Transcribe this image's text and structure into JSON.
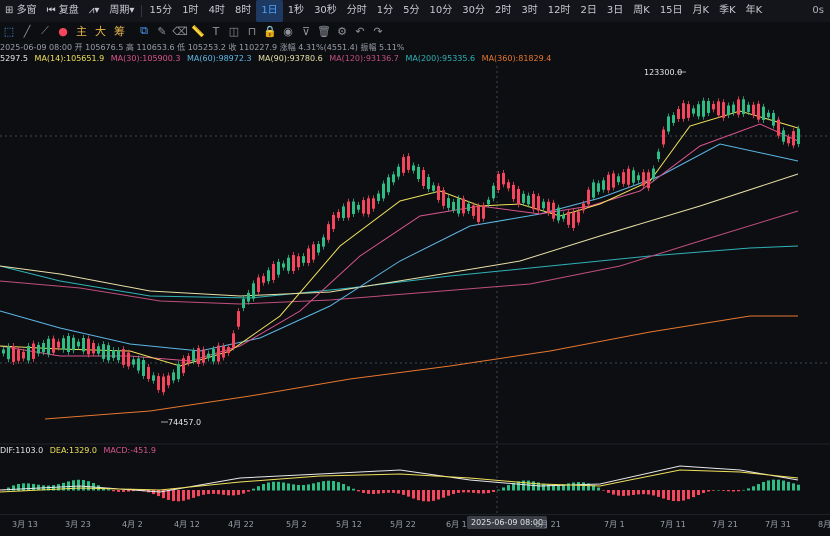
{
  "toolbar": {
    "multi_window": "多窗",
    "replay": "复盘",
    "period": "周期",
    "timeframes": [
      "15分",
      "1时",
      "4时",
      "8时",
      "1日",
      "1秒",
      "30秒",
      "分时",
      "1分",
      "5分",
      "10分",
      "30分",
      "2时",
      "3时",
      "12时",
      "2日",
      "3日",
      "周K",
      "15日",
      "月K",
      "季K",
      "年K"
    ],
    "active_timeframe": "1日",
    "right_value": "0s"
  },
  "drawbar": {
    "main": "主",
    "big": "大",
    "chips": "筹"
  },
  "info": {
    "date": "2025-06-09 08:00",
    "open": "开 105676.5",
    "high": "高 110653.6",
    "low": "低 105253.2",
    "close": "收 110227.9",
    "change": "涨幅 4.31%(4551.4)",
    "amplitude": "振幅 5.11%"
  },
  "ma": {
    "ma7": "5297.5",
    "ma14": "MA(14):105651.9",
    "ma30": "MA(30):105900.3",
    "ma60": "MA(60):98972.3",
    "ma90": "MA(90):93780.6",
    "ma120": "MA(120):93136.7",
    "ma200": "MA(200):95335.6",
    "ma360": "MA(360):81829.4"
  },
  "colors": {
    "up": "#2ebd85",
    "down": "#f6465d",
    "ma14": "#f0e15a",
    "ma30": "#d9548e",
    "ma60": "#5cb8e6",
    "ma90": "#e8e0a6",
    "ma120": "#c04f7d",
    "ma200": "#2fb3b8",
    "ma360": "#e8772e"
  },
  "annotations": {
    "high": "123300.0",
    "low": "74457.0"
  },
  "macd": {
    "dif": "DIF:1103.0",
    "dea": "DEA:1329.0",
    "macd": "MACD:-451.9"
  },
  "xaxis": {
    "labels": [
      "3月 13",
      "3月 23",
      "4月 2",
      "4月 12",
      "4月 22",
      "5月 2",
      "5月 12",
      "5月 22",
      "6月 1",
      "6月 21",
      "7月 1",
      "7月 11",
      "7月 21",
      "7月 31",
      "8月"
    ],
    "crosshair_date": "2025-06-09 08:00"
  }
}
